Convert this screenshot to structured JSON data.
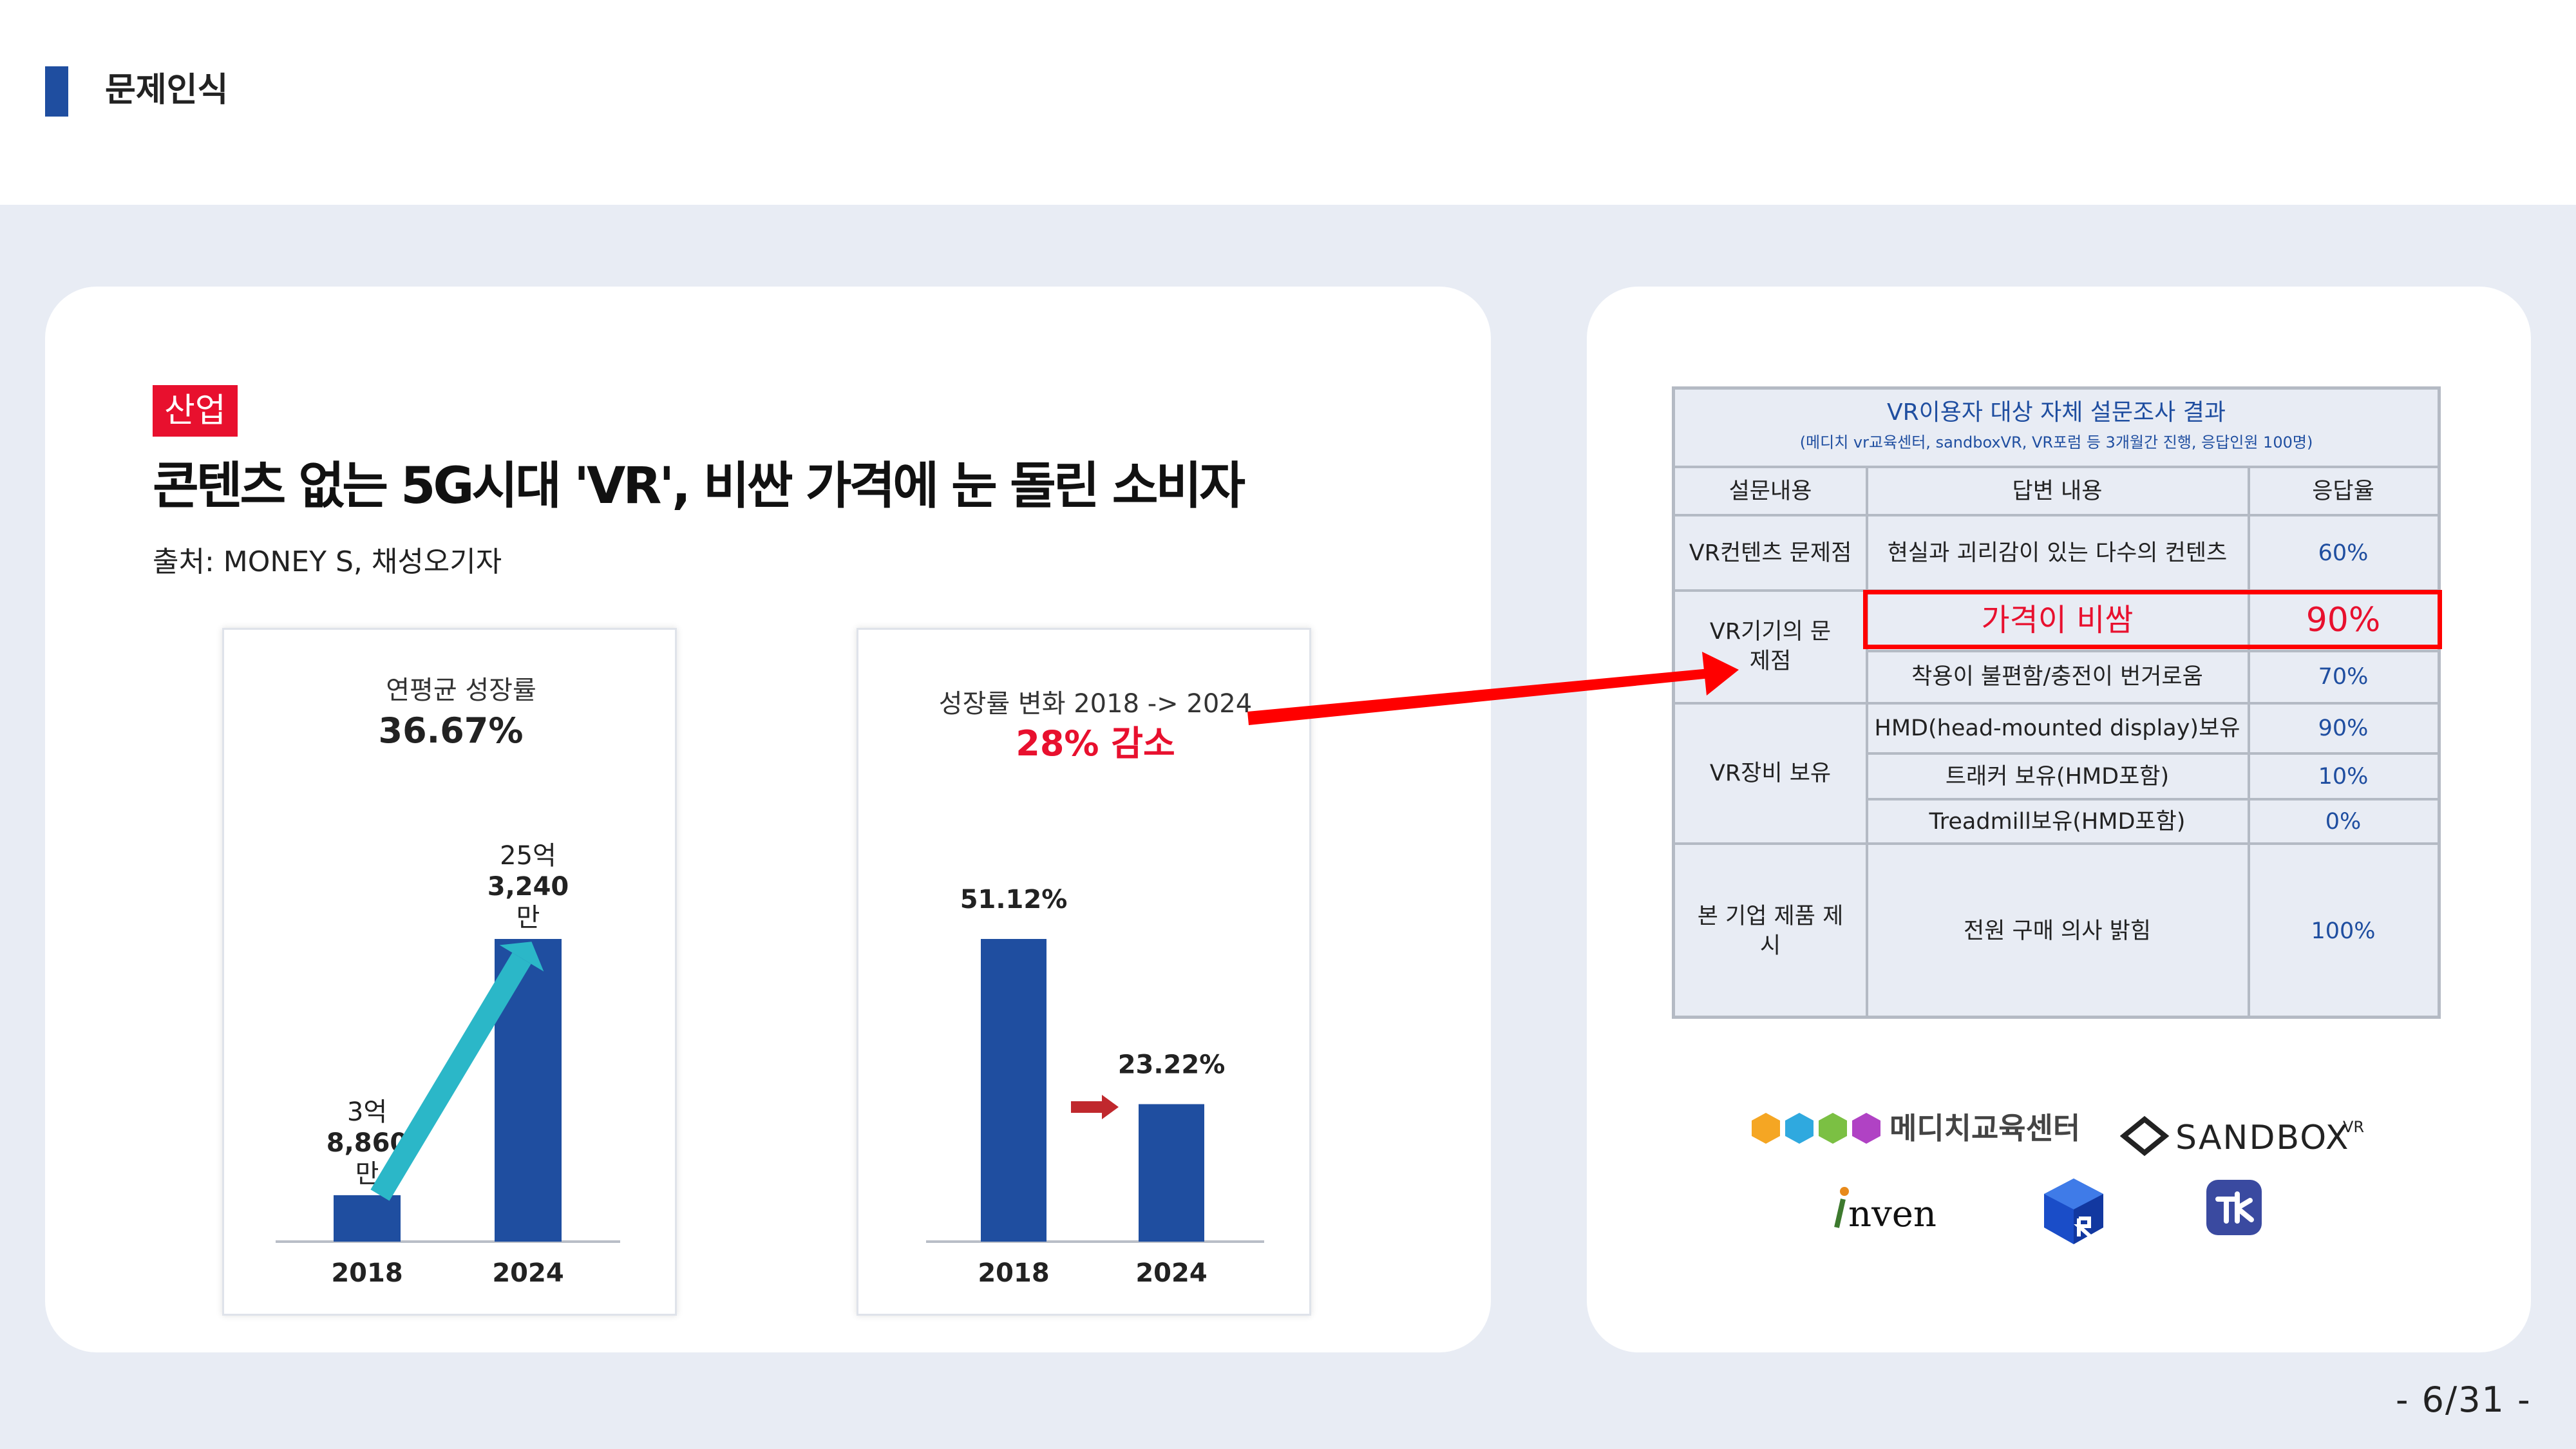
{
  "header": {
    "title": "문제인식"
  },
  "article": {
    "tag": "산업",
    "headline": "콘텐츠 없는 5G시대 'VR', 비싼 가격에 눈 돌린 소비자",
    "source": "출처: MONEY S, 채성오기자"
  },
  "chart_data": [
    {
      "type": "bar",
      "title": "연평균 성장률",
      "subtitle": "36.67%",
      "categories": [
        "2018",
        "2024"
      ],
      "values": [
        388600000,
        2532400000
      ],
      "value_labels": [
        "3억 8,860 만",
        "25억 3,240 만"
      ],
      "colors": {
        "bar": "#1f4ea0",
        "trend_arrow": "#2bb7c8"
      }
    },
    {
      "type": "bar",
      "title": "성장률 변화 2018 -> 2024",
      "subtitle": "28% 감소",
      "categories": [
        "2018",
        "2024"
      ],
      "values": [
        51.12,
        23.22
      ],
      "value_labels": [
        "51.12%",
        "23.22%"
      ],
      "colors": {
        "bar": "#1f4ea0",
        "change_arrow": "#c0282d",
        "subtitle": "#e8102e"
      }
    }
  ],
  "survey": {
    "title": "VR이용자 대상 자체 설문조사 결과",
    "subtitle": "(메디치 vr교육센터, sandboxVR, VR포럼 등 3개월간 진행, 응답인원 100명)",
    "headers": [
      "설문내용",
      "답변 내용",
      "응답율"
    ],
    "rows": [
      {
        "topic": "VR컨텐츠 문제점",
        "answer": "현실과 괴리감이 있는 다수의 컨텐츠",
        "rate": "60%"
      },
      {
        "topic": "VR기기의 문제점",
        "answer": "가격이 비쌈",
        "rate": "90%"
      },
      {
        "topic": "",
        "answer": "착용이 불편함/충전이 번거로움",
        "rate": "70%"
      },
      {
        "topic": "VR장비 보유",
        "answer": "HMD(head-mounted display)보유",
        "rate": "90%"
      },
      {
        "topic": "",
        "answer": "트래커 보유(HMD포함)",
        "rate": "10%"
      },
      {
        "topic": "",
        "answer": "Treadmill보유(HMD포함)",
        "rate": "0%"
      },
      {
        "topic": "본 기업 제품 제시",
        "answer": "전원 구매 의사 밝힘",
        "rate": "100%"
      }
    ]
  },
  "logos": {
    "medici": "메디치교육센터",
    "sandbox": "SANDBOX",
    "sandbox_sup": "VR",
    "inven": "nven"
  },
  "colors": {
    "accent": "#1f4ea0",
    "highlight": "#ff0000",
    "tag": "#e8102e"
  },
  "page": "- 6/31 -"
}
